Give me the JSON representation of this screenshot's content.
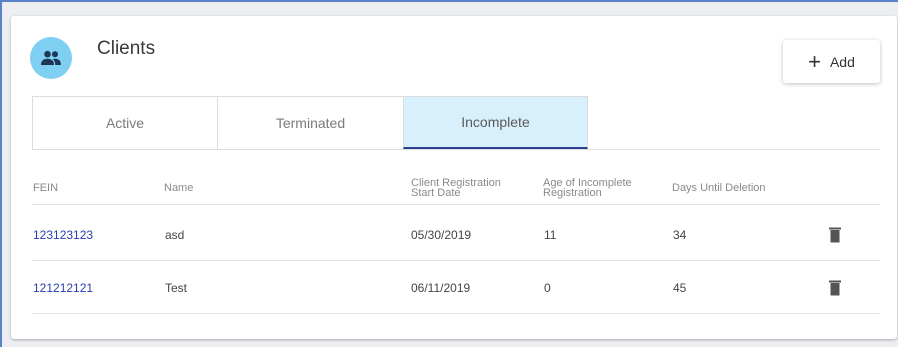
{
  "header": {
    "title": "Clients",
    "icon": "people-icon",
    "icon_bg_color": "#7fcff3"
  },
  "add_button": {
    "icon": "plus-icon",
    "label": "Add"
  },
  "tabs": [
    {
      "label": "Active",
      "selected": false
    },
    {
      "label": "Terminated",
      "selected": false
    },
    {
      "label": "Incomplete",
      "selected": true
    }
  ],
  "table": {
    "columns": [
      "FEIN",
      "Name",
      [
        "Client Registration",
        "Start Date"
      ],
      [
        "Age of Incomplete",
        "Registration"
      ],
      "Days Until Deletion"
    ],
    "rows": [
      {
        "fein": "123123123",
        "name": "asd",
        "start_date": "05/30/2019",
        "age": "11",
        "days_until_deletion": "34",
        "action_icon": "trash-icon"
      },
      {
        "fein": "121212121",
        "name": "Test",
        "start_date": "06/11/2019",
        "age": "0",
        "days_until_deletion": "45",
        "action_icon": "trash-icon"
      }
    ]
  },
  "colors": {
    "accent": "#2b3f8f",
    "selected_tab_bg": "#d8f0fb",
    "link": "#2a3db0"
  }
}
